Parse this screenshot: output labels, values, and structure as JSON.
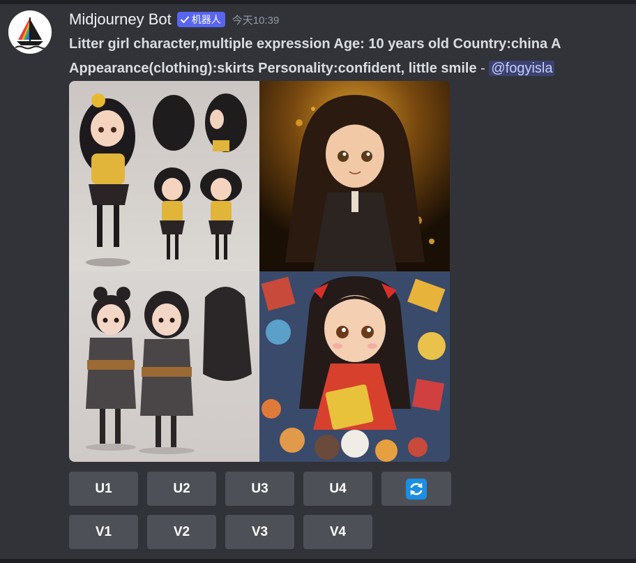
{
  "message": {
    "author": "Midjourney Bot",
    "bot_tag": "机器人",
    "timestamp": "今天10:39",
    "prompt_line1": "Litter girl character,multiple expression Age: 10 years old Country:china A",
    "prompt_line2": "Appearance(clothing):skirts Personality:confident, little smile",
    "prompt_sep": " - ",
    "mention": "@fogyisla"
  },
  "buttons": {
    "upscale": [
      "U1",
      "U2",
      "U3",
      "U4"
    ],
    "variation": [
      "V1",
      "V2",
      "V3",
      "V4"
    ],
    "reroll_icon": "refresh-icon"
  },
  "colors": {
    "background": "#313338",
    "button": "#4e5058",
    "bot_tag": "#5865f2",
    "mention_bg": "#3c4270",
    "reroll_icon": "#1a8fe3"
  }
}
